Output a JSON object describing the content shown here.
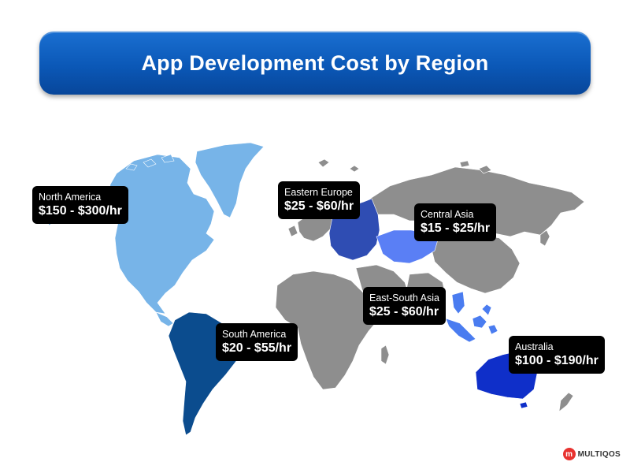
{
  "title": "App Development Cost by Region",
  "colors": {
    "banner": "#0b58b7",
    "land_default": "#8e8e8e",
    "north_america": "#77b4e8",
    "eastern_europe": "#2f4db3",
    "central_asia": "#5a7ff5",
    "east_south_asia": "#4a7cf0",
    "south_america": "#0b4c8e",
    "australia": "#0f2fc9",
    "callout_bg": "#000000"
  },
  "regions": [
    {
      "id": "north-america",
      "name": "North America",
      "cost": "$150 - $300/hr"
    },
    {
      "id": "eastern-europe",
      "name": "Eastern Europe",
      "cost": "$25 - $60/hr"
    },
    {
      "id": "central-asia",
      "name": "Central Asia",
      "cost": "$15 - $25/hr"
    },
    {
      "id": "east-south-asia",
      "name": "East-South Asia",
      "cost": "$25 - $60/hr"
    },
    {
      "id": "south-america",
      "name": "South America",
      "cost": "$20 - $55/hr"
    },
    {
      "id": "australia",
      "name": "Australia",
      "cost": "$100 - $190/hr"
    }
  ],
  "logo": {
    "text": "MULTIQOS",
    "mark": "m"
  }
}
